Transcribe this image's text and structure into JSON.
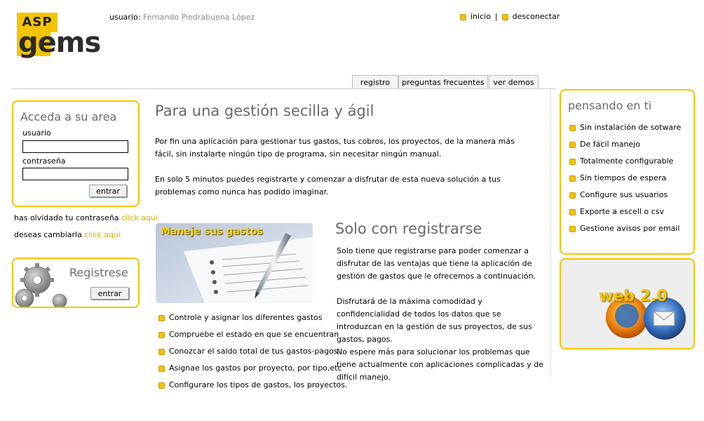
{
  "header": {
    "logo_top": "ASP",
    "logo_bottom": "gems",
    "user_label": "usuario:",
    "user_name": "Fernando Piedrabuena López",
    "links": [
      "inicio",
      "desconectar"
    ],
    "link_separator": "|"
  },
  "tabs": [
    "registro",
    "preguntas frecuentes",
    "ver demos"
  ],
  "login": {
    "title": "Acceda a su area",
    "user_label": "usuario",
    "password_label": "contraseña",
    "user_value": "",
    "password_value": "",
    "submit_label": "entrar",
    "forgot_text": "has olvidado tu contraseña",
    "forgot_link": "click aqui",
    "change_text": "deseas cambiarla",
    "change_link": "click aqui"
  },
  "register": {
    "title": "Registrese",
    "button_label": "entrar"
  },
  "main": {
    "title": "Para una gestión secilla y ágil",
    "para1": "Por fin una aplicación para gestionar tus gastos, tus cobros, los proyectos,  de la manera más fácil, sin instalarte ningún tipo de programa, sin necesitar ningún manual.",
    "para2": "En solo 5 minutos puedes registrarte y comenzar a disfrutar de esta nueva solución a tus problemas como nunca has podido imaginar.",
    "photo_caption": "Maneje sus gastos",
    "features": [
      "Controle y asignar los diferentes gastos",
      "Compruebe el estado en que se encuentran",
      "Conozcar el saldo total de tus gastos-pagos.",
      "Asignae los gastos por proyecto, por tipo,etc",
      "Configurare los tipos de gastos, los proyectos."
    ],
    "title2": "Solo con registrarse",
    "para3": "Solo tiene que registrarse para poder comenzar a disfrutar de las ventajas que tiene la aplicación de gestión de gastos que le ofrecemos a continuación.",
    "para4": "Disfrutará de la máxima comodidad y confidencialidad de todos los datos que se introduzcan en la gestión de sus proyectos, de sus gastos, pagos.",
    "para5": "No espere más para solucionar los problemas que tiene actualmente con aplicaciones complicadas y de difícil manejo."
  },
  "sidebar": {
    "title": "pensando en ti",
    "items": [
      "Sin instalación de sotware",
      "De fácil manejo",
      "Totalmente configurable",
      "Sin tiempos de espera",
      "Configure sus usuarios",
      "Exporte a escell o csv",
      "Gestione avisos por email"
    ],
    "web_badge": "web 2.0"
  },
  "colors": {
    "accent": "#f5c400",
    "link": "#e0a800",
    "heading": "#6a6a6a"
  }
}
